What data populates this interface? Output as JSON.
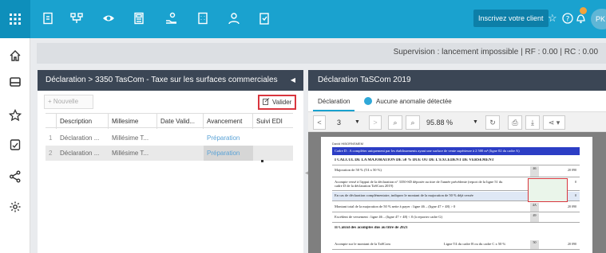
{
  "topbar": {
    "icons": [
      "apps-grid-icon",
      "document-icon",
      "org-chart-icon",
      "eye-icon",
      "calculator-icon",
      "hand-money-icon",
      "building-icon",
      "user-icon",
      "clipboard-icon"
    ],
    "cta_label": "Inscrivez votre client",
    "user_initials": "PK"
  },
  "sidebar": {
    "icons": [
      "home-icon",
      "inbox-icon",
      "star-icon",
      "note-icon",
      "share-icon",
      "settings-icon"
    ]
  },
  "supervision": {
    "text": "Supervision : lancement impossible  | RF : 0.00 | RC : 0.00"
  },
  "left_panel": {
    "title": "Déclaration > 3350 TasCom - Taxe sur les surfaces commerciales",
    "collapse_glyph": "◀",
    "new_label": "+ Nouvelle",
    "validate_label": "Valider",
    "columns": [
      "Description",
      "Millesime",
      "Date Valid...",
      "Avancement",
      "Suivi EDI"
    ],
    "rows": [
      {
        "num": "1",
        "description": "Déclaration ...",
        "millesime": "Millésime T...",
        "date": "",
        "avancement": "Préparation",
        "edi": ""
      },
      {
        "num": "2",
        "description": "Déclaration ...",
        "millesime": "Millésime T...",
        "date": "",
        "avancement": "Préparation",
        "edi": ""
      }
    ]
  },
  "right_panel": {
    "title": "Déclaration TaSCom 2019",
    "tab_label": "Déclaration",
    "anomaly_label": "Aucune anomalie détectée",
    "viewer": {
      "page": "3",
      "zoom": "95.88 %"
    },
    "document": {
      "company": "David HIBORNSMEM",
      "cadre_title": "Cadre D : A compléter uniquement par les établissements ayant une surface de vente supérieure à 2 500 m² (ligne 02 du cadre A)",
      "section1": "I CALCUL DE LA MAJORATION DE 50 % DUE OU DE L'EXCEDENT DE VERSEMENT",
      "lines": [
        {
          "text": "Majoration de 50 % (T4 x 50 %)",
          "code": "46",
          "value": "20 090"
        },
        {
          "text": "Acompte versé à l'appui de la déclaration n° 3350-SD déposée au titre de l'année précédente (report de la ligne 51 du cadre D de la déclaration TaSCom 2019)",
          "code": "47",
          "value": "0"
        },
        {
          "text": "En cas de déclaration complémentaire, indiquez le montant de la majoration de 50 % déjà versée",
          "code": "48",
          "value": "0"
        },
        {
          "text": "Montant total de la majoration de 50 % nette à payer : ligne 46 – (ligne 47 + 48) > 0",
          "code": "4A",
          "value": "20 090"
        },
        {
          "text": "Excédent de versement : ligne 46 – (ligne 47 + 48) < 0 (à reporter cadre G)",
          "code": "49",
          "value": ""
        }
      ],
      "section2": "II Calcul des acomptes dus au titre de 2021",
      "last_line": {
        "text": "Acompte sur le montant de la TaSCom",
        "mid": "Ligne T4 du cadre B ou du cadre C x 50 %",
        "code": "50",
        "value": "20 090"
      }
    }
  }
}
